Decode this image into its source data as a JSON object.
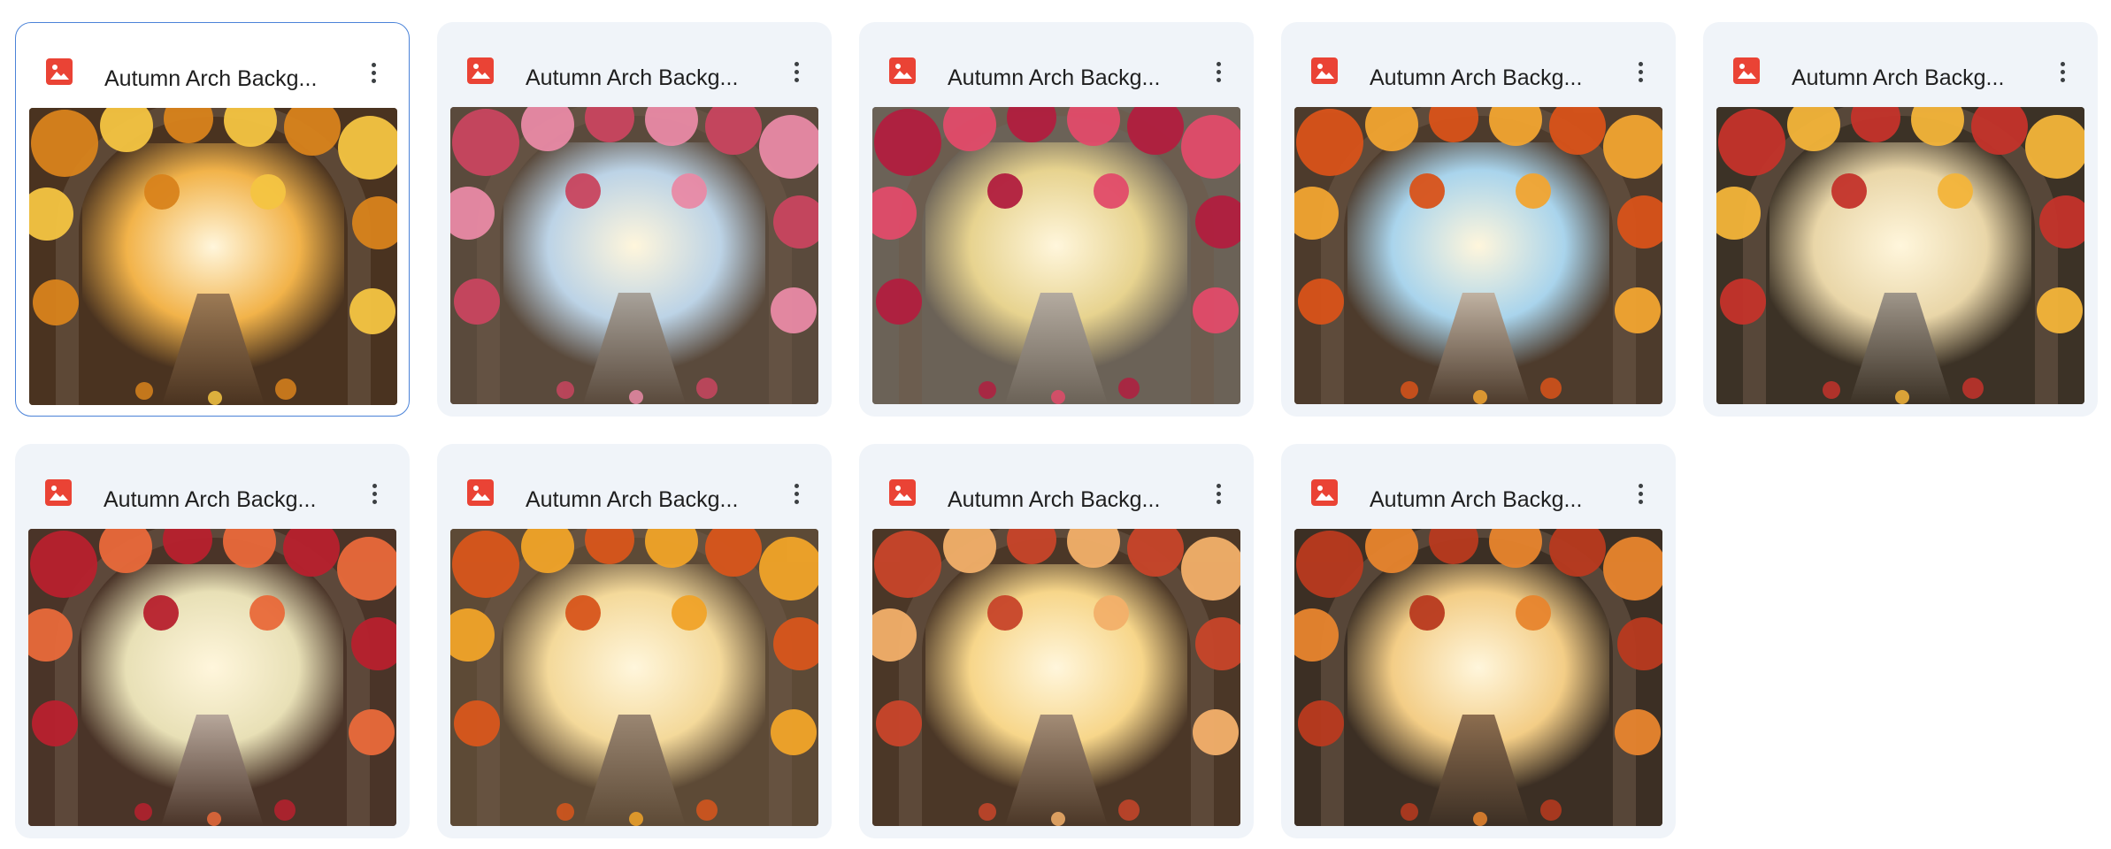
{
  "files": [
    {
      "title": "Autumn Arch Backg...",
      "icon": "image-file-icon",
      "selected": true,
      "palette": {
        "sky": "#f2b34a",
        "arch": "#4a3320",
        "foliage": "#d9831c",
        "accent": "#f5c542",
        "path": "#9c7a55"
      }
    },
    {
      "title": "Autumn Arch Backg...",
      "icon": "image-file-icon",
      "selected": false,
      "palette": {
        "sky": "#bcd3e6",
        "arch": "#5a4a3c",
        "foliage": "#c9455f",
        "accent": "#e98aa6",
        "path": "#a8a29a"
      }
    },
    {
      "title": "Autumn Arch Backg...",
      "icon": "image-file-icon",
      "selected": false,
      "palette": {
        "sky": "#e7d38f",
        "arch": "#6b6257",
        "foliage": "#b21e3f",
        "accent": "#e24b6a",
        "path": "#b4aba0"
      }
    },
    {
      "title": "Autumn Arch Backg...",
      "icon": "image-file-icon",
      "selected": false,
      "palette": {
        "sky": "#a9d4ec",
        "arch": "#4d3b2c",
        "foliage": "#d9531a",
        "accent": "#f2a531",
        "path": "#c0b2a2"
      }
    },
    {
      "title": "Autumn Arch Backg...",
      "icon": "image-file-icon",
      "selected": false,
      "palette": {
        "sky": "#e9d6a8",
        "arch": "#3c3226",
        "foliage": "#c4332b",
        "accent": "#f4b53a",
        "path": "#9f968a"
      }
    },
    {
      "title": "Autumn Arch Backg...",
      "icon": "image-file-icon",
      "selected": false,
      "palette": {
        "sky": "#e8e0b6",
        "arch": "#4a3428",
        "foliage": "#b8212e",
        "accent": "#e96a3a",
        "path": "#b7a79b"
      }
    },
    {
      "title": "Autumn Arch Backg...",
      "icon": "image-file-icon",
      "selected": false,
      "palette": {
        "sky": "#f4d99a",
        "arch": "#5d4a36",
        "foliage": "#d8561c",
        "accent": "#f1a429",
        "path": "#9a8672"
      }
    },
    {
      "title": "Autumn Arch Backg...",
      "icon": "image-file-icon",
      "selected": false,
      "palette": {
        "sky": "#f7d68a",
        "arch": "#4b3727",
        "foliage": "#c8452a",
        "accent": "#f3b06a",
        "path": "#a38c76"
      }
    },
    {
      "title": "Autumn Arch Backg...",
      "icon": "image-file-icon",
      "selected": false,
      "palette": {
        "sky": "#f3cd86",
        "arch": "#3c2f24",
        "foliage": "#b93a1f",
        "accent": "#e8852e",
        "path": "#8c6d4f"
      }
    }
  ]
}
